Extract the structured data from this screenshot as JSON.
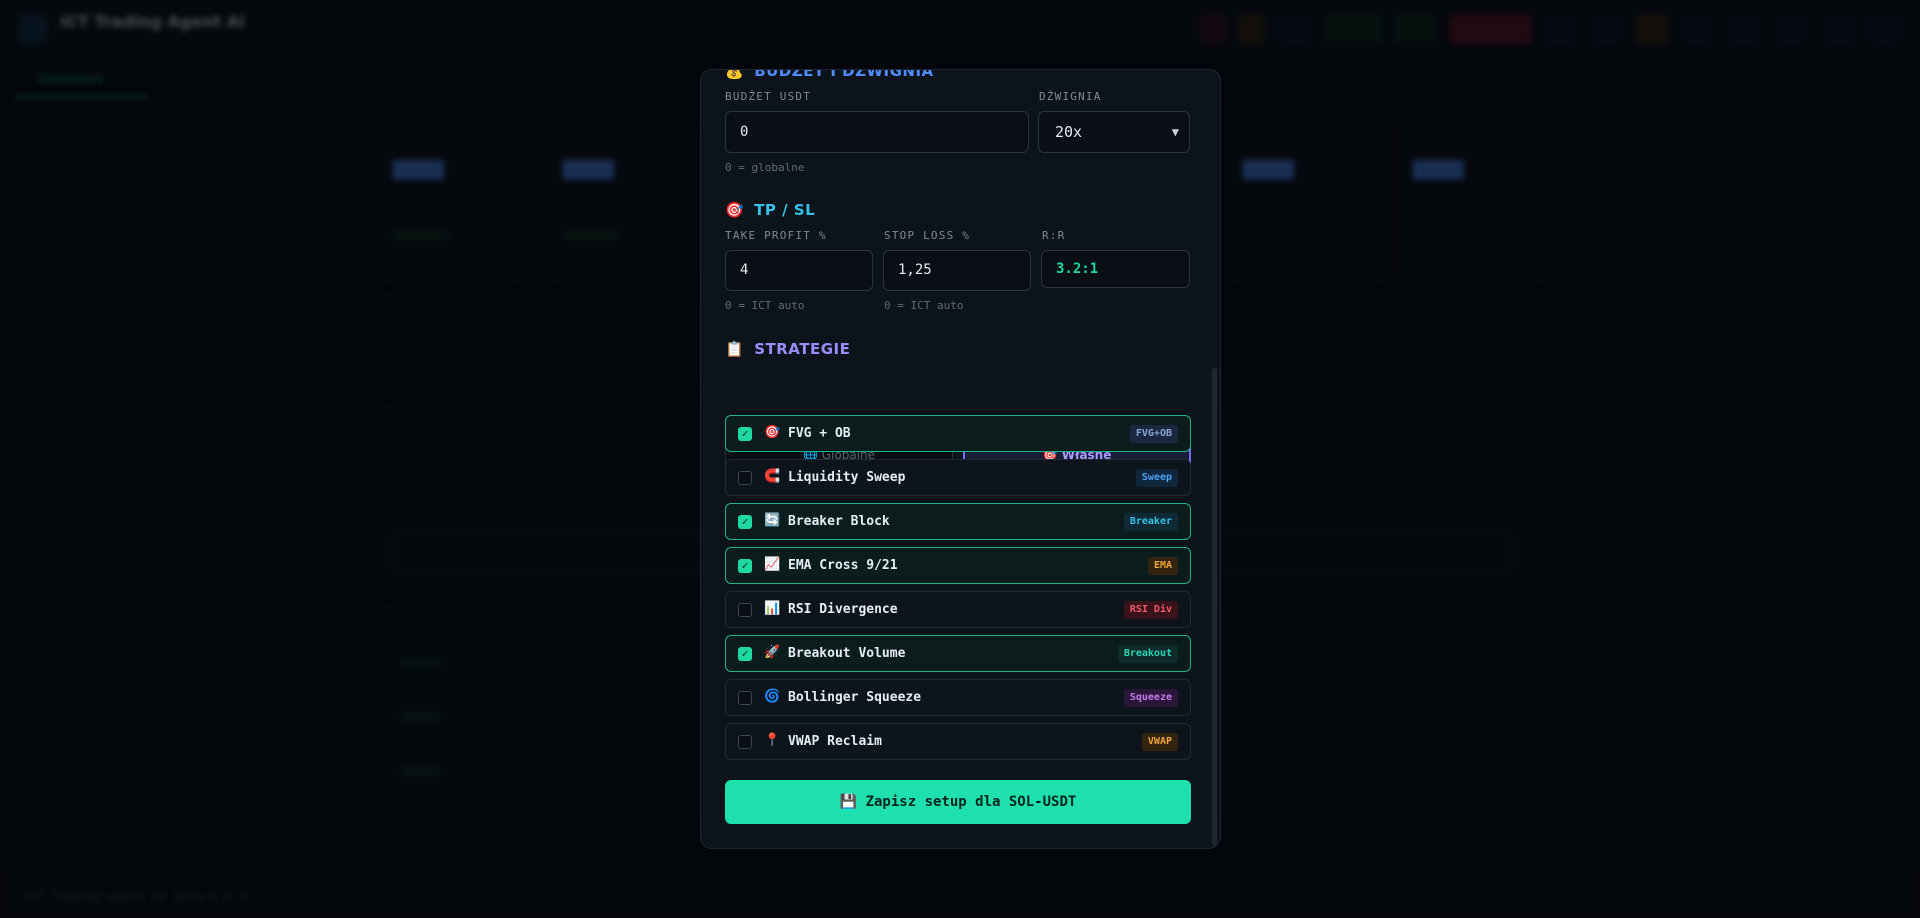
{
  "app": {
    "title": "ICT Trading Agent AI",
    "tabs": [
      "Dashboard"
    ],
    "footer": "ICT Trading Agent AI Gold 6.0.7"
  },
  "modal": {
    "budget_section": {
      "icon": "💰",
      "title": "BUDŻET I DŹWIGNIA"
    },
    "budget": {
      "label": "BUDŻET USDT",
      "value": "0",
      "hint": "0 = globalne"
    },
    "leverage": {
      "label": "DŹWIGNIA",
      "value": "20x"
    },
    "tpsl_section": {
      "icon": "🎯",
      "title": "TP / SL"
    },
    "tp": {
      "label": "TAKE PROFIT %",
      "value": "4",
      "hint": "0 = ICT auto"
    },
    "sl": {
      "label": "STOP LOSS %",
      "value": "1,25",
      "hint": "0 = ICT auto"
    },
    "rr": {
      "label": "R:R",
      "value": "3.2:1"
    },
    "strategies_section": {
      "icon": "📋",
      "title": "STRATEGIE"
    },
    "mode": {
      "global": {
        "icon": "🌐",
        "label": "Globalne",
        "selected": false
      },
      "own": {
        "icon": "🎯",
        "label": "Własne",
        "selected": true
      }
    },
    "strategies": [
      {
        "icon": "🎯",
        "name": "FVG + OB",
        "badge": "FVG+OB",
        "checked": true,
        "badge_color": "#8aa4d6",
        "badge_bg": "#1b2740"
      },
      {
        "icon": "🧲",
        "name": "Liquidity Sweep",
        "badge": "Sweep",
        "checked": false,
        "badge_color": "#4aa3f5",
        "badge_bg": "#10263d"
      },
      {
        "icon": "🔄",
        "name": "Breaker Block",
        "badge": "Breaker",
        "checked": true,
        "badge_color": "#35c2e8",
        "badge_bg": "#0f2a36"
      },
      {
        "icon": "📈",
        "name": "EMA Cross 9/21",
        "badge": "EMA",
        "checked": true,
        "badge_color": "#f0a43a",
        "badge_bg": "#33240f"
      },
      {
        "icon": "📊",
        "name": "RSI Divergence",
        "badge": "RSI Div",
        "checked": false,
        "badge_color": "#f05a6a",
        "badge_bg": "#3a1219"
      },
      {
        "icon": "🚀",
        "name": "Breakout Volume",
        "badge": "Breakout",
        "checked": true,
        "badge_color": "#2ad6b4",
        "badge_bg": "#0e2b2a"
      },
      {
        "icon": "🌀",
        "name": "Bollinger Squeeze",
        "badge": "Squeeze",
        "checked": false,
        "badge_color": "#c47af0",
        "badge_bg": "#2a1638"
      },
      {
        "icon": "📍",
        "name": "VWAP Reclaim",
        "badge": "VWAP",
        "checked": false,
        "badge_color": "#f0a43a",
        "badge_bg": "#33240f"
      }
    ],
    "save_button": {
      "icon": "💾",
      "label": "Zapisz setup dla SOL-USDT"
    }
  },
  "colors": {
    "accent": "#1de0ae",
    "purple": "#7a6cf0",
    "section_budget": "#4f8cff",
    "section_tpsl": "#35c2e8",
    "section_strat": "#9b8cff"
  }
}
